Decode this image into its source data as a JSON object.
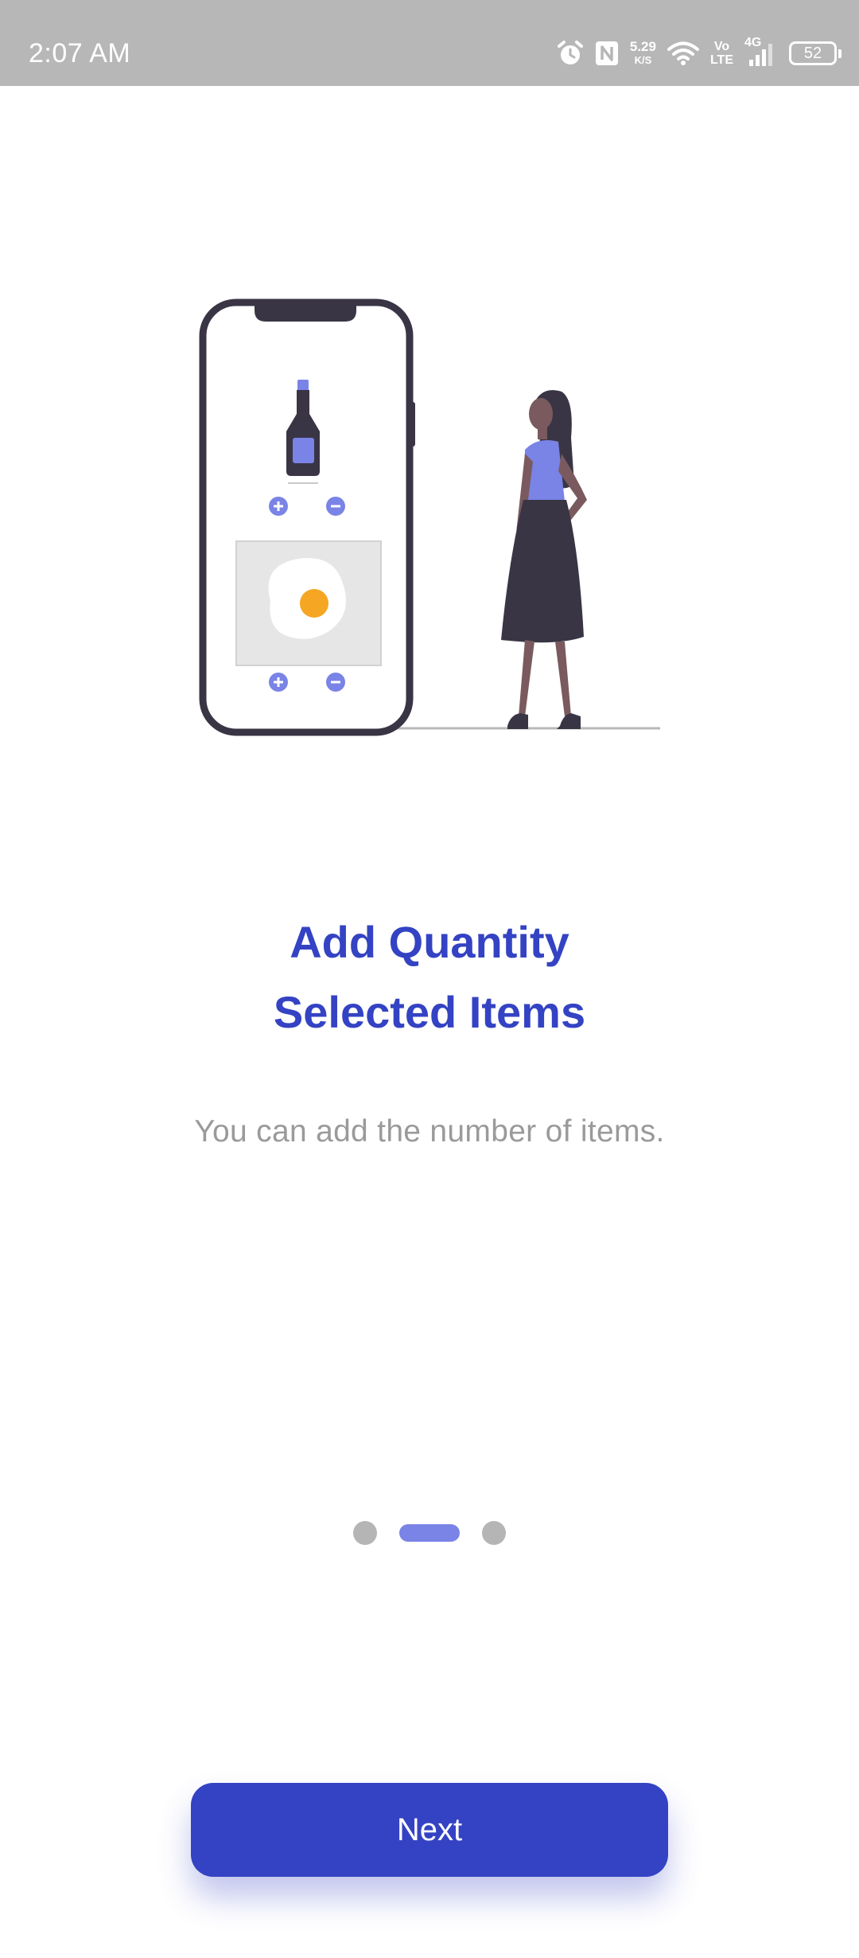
{
  "status_bar": {
    "time": "2:07 AM",
    "net_speed_value": "5.29",
    "net_speed_unit": "K/S",
    "volte_top": "Vo",
    "volte_bottom": "LTE",
    "network_type": "4G",
    "battery_level": "52",
    "icons": [
      "alarm-icon",
      "nfc-icon",
      "wifi-icon",
      "signal-icon",
      "battery-icon"
    ]
  },
  "onboarding": {
    "title_line1": "Add Quantity",
    "title_line2": "Selected Items",
    "subtitle": "You can add the number of items.",
    "page_count": 3,
    "active_page": 2,
    "next_label": "Next"
  },
  "colors": {
    "primary": "#3443c3",
    "accent": "#7a83e6",
    "status_bar_bg": "#b7b7b7",
    "subtitle": "#9a9a9a",
    "dot_inactive": "#b5b5b5",
    "illustration_dark": "#3a3545",
    "egg_yolk": "#f5a623"
  }
}
